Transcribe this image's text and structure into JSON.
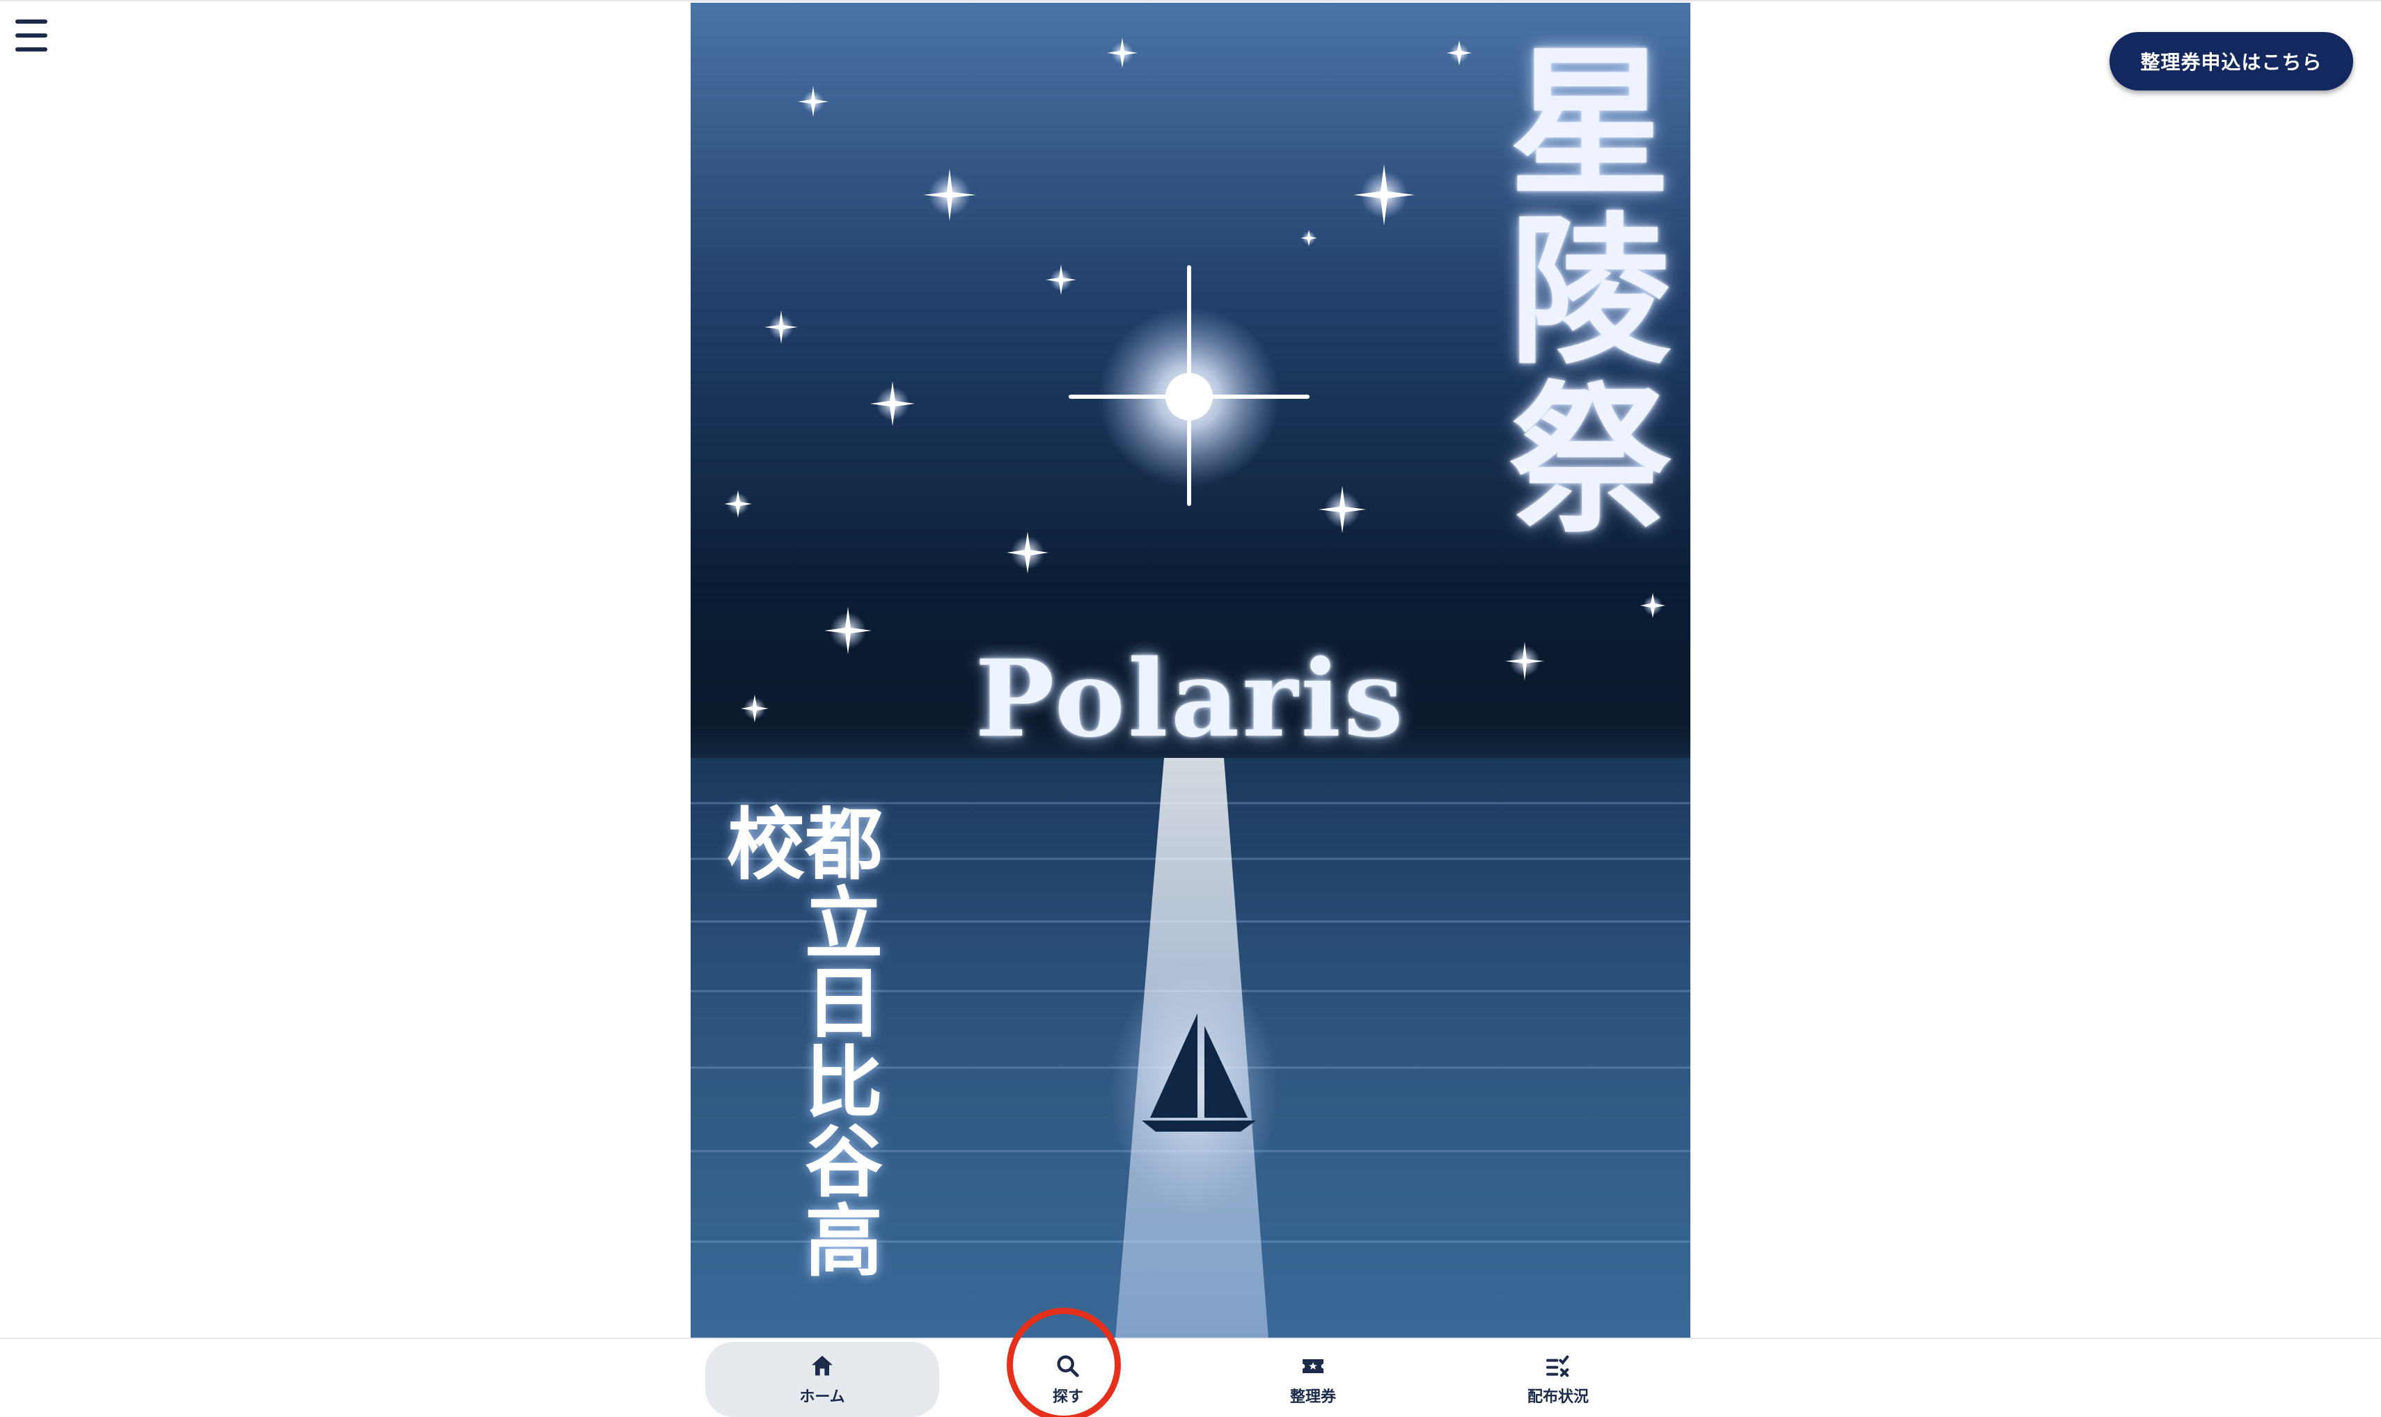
{
  "header": {
    "cta_label": "整理券申込はこちら"
  },
  "poster": {
    "title": "星陵祭",
    "subtitle": "Polaris",
    "school": "都立日比谷高校"
  },
  "bottom_nav": {
    "items": [
      {
        "label": "ホーム",
        "icon": "home-icon",
        "active": true
      },
      {
        "label": "探す",
        "icon": "search-icon",
        "active": false
      },
      {
        "label": "整理券",
        "icon": "ticket-icon",
        "active": false
      },
      {
        "label": "配布状況",
        "icon": "checklist-icon",
        "active": false
      }
    ]
  },
  "colors": {
    "brand_navy": "#13285e",
    "text_navy": "#1c2b4a",
    "highlight": "#e5311c"
  }
}
